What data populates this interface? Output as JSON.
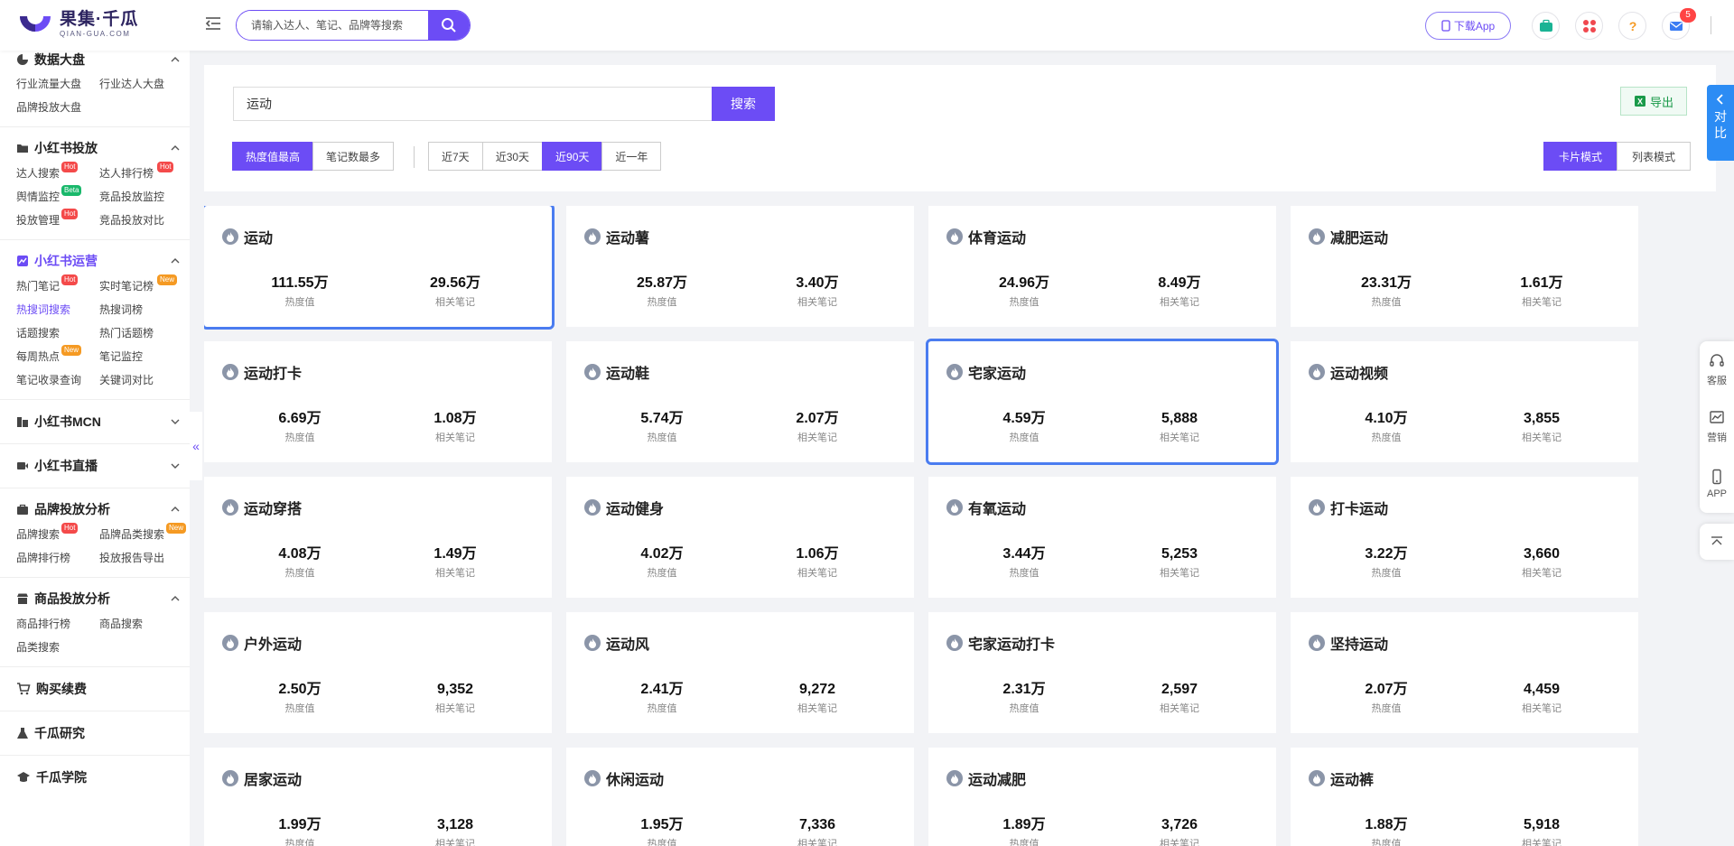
{
  "header": {
    "logo_name": "果集·千瓜",
    "logo_sub": "QIAN-GUA.COM",
    "search_placeholder": "请输入达人、笔记、品牌等搜索",
    "download_label": "下载App",
    "notification_count": "5",
    "colors": {
      "brand": "#6c4cf5"
    }
  },
  "sidebar": {
    "groups": [
      {
        "title": "数据大盘",
        "items": [
          "行业流量大盘",
          "行业达人大盘",
          "品牌投放大盘"
        ]
      },
      {
        "title": "小红书投放",
        "items": [
          "达人搜索",
          "达人排行榜",
          "舆情监控",
          "竞品投放监控",
          "投放管理",
          "竞品投放对比"
        ]
      },
      {
        "title": "小红书运营",
        "items": [
          "热门笔记",
          "实时笔记榜",
          "热搜词搜索",
          "热搜词榜",
          "话题搜索",
          "热门话题榜",
          "每周热点",
          "笔记监控",
          "笔记收录查询",
          "关键词对比"
        ]
      },
      {
        "title": "小红书MCN"
      },
      {
        "title": "小红书直播"
      },
      {
        "title": "品牌投放分析",
        "items": [
          "品牌搜索",
          "品牌品类搜索",
          "品牌排行榜",
          "投放报告导出"
        ]
      },
      {
        "title": "商品投放分析",
        "items": [
          "商品排行榜",
          "商品搜索",
          "品类搜索"
        ]
      },
      {
        "title": "购买续费"
      },
      {
        "title": "千瓜研究"
      },
      {
        "title": "千瓜学院"
      }
    ],
    "tags": {
      "hot": "Hot",
      "beta": "Beta",
      "new": "New"
    }
  },
  "filters": {
    "keyword": "运动",
    "search_label": "搜索",
    "export_label": "导出",
    "sort": [
      "热度值最高",
      "笔记数最多"
    ],
    "range": [
      "近7天",
      "近30天",
      "近90天",
      "近一年"
    ],
    "mode": [
      "卡片模式",
      "列表模式"
    ]
  },
  "compare_tab": [
    "对",
    "比"
  ],
  "right_tools": [
    "客服",
    "营销",
    "APP"
  ],
  "labels": {
    "heat": "热度值",
    "notes": "相关笔记"
  },
  "cards": [
    {
      "title": "运动",
      "heat": "111.55万",
      "notes": "29.56万",
      "highlight": true
    },
    {
      "title": "运动薯",
      "heat": "25.87万",
      "notes": "3.40万"
    },
    {
      "title": "体育运动",
      "heat": "24.96万",
      "notes": "8.49万"
    },
    {
      "title": "减肥运动",
      "heat": "23.31万",
      "notes": "1.61万"
    },
    {
      "title": "运动打卡",
      "heat": "6.69万",
      "notes": "1.08万"
    },
    {
      "title": "运动鞋",
      "heat": "5.74万",
      "notes": "2.07万"
    },
    {
      "title": "宅家运动",
      "heat": "4.59万",
      "notes": "5,888",
      "highlight": true
    },
    {
      "title": "运动视频",
      "heat": "4.10万",
      "notes": "3,855"
    },
    {
      "title": "运动穿搭",
      "heat": "4.08万",
      "notes": "1.49万"
    },
    {
      "title": "运动健身",
      "heat": "4.02万",
      "notes": "1.06万"
    },
    {
      "title": "有氧运动",
      "heat": "3.44万",
      "notes": "5,253"
    },
    {
      "title": "打卡运动",
      "heat": "3.22万",
      "notes": "3,660"
    },
    {
      "title": "户外运动",
      "heat": "2.50万",
      "notes": "9,352"
    },
    {
      "title": "运动风",
      "heat": "2.41万",
      "notes": "9,272"
    },
    {
      "title": "宅家运动打卡",
      "heat": "2.31万",
      "notes": "2,597"
    },
    {
      "title": "坚持运动",
      "heat": "2.07万",
      "notes": "4,459"
    },
    {
      "title": "居家运动",
      "heat": "1.99万",
      "notes": "3,128"
    },
    {
      "title": "休闲运动",
      "heat": "1.95万",
      "notes": "7,336"
    },
    {
      "title": "运动减肥",
      "heat": "1.89万",
      "notes": "3,726"
    },
    {
      "title": "运动裤",
      "heat": "1.88万",
      "notes": "5,918"
    }
  ]
}
